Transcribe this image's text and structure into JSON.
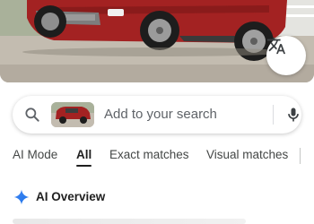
{
  "photo": {
    "subject_icon": "car-photo",
    "car_color": "#a32222"
  },
  "photo_actions": {
    "translate_icon": "translate-icon"
  },
  "search": {
    "search_icon": "search-icon",
    "placeholder": "Add to your search",
    "thumbnail_icon": "car-thumbnail",
    "mic_icon": "mic-icon"
  },
  "tabs": [
    {
      "label": "AI Mode",
      "active": false
    },
    {
      "label": "All",
      "active": true
    },
    {
      "label": "Exact matches",
      "active": false
    },
    {
      "label": "Visual matches",
      "active": false
    }
  ],
  "ai_overview": {
    "icon": "sparkle-icon",
    "label": "AI Overview"
  },
  "colors": {
    "accent_blue": "#4285f4",
    "text_primary": "#1f1f1f",
    "text_secondary": "#5f6368"
  }
}
